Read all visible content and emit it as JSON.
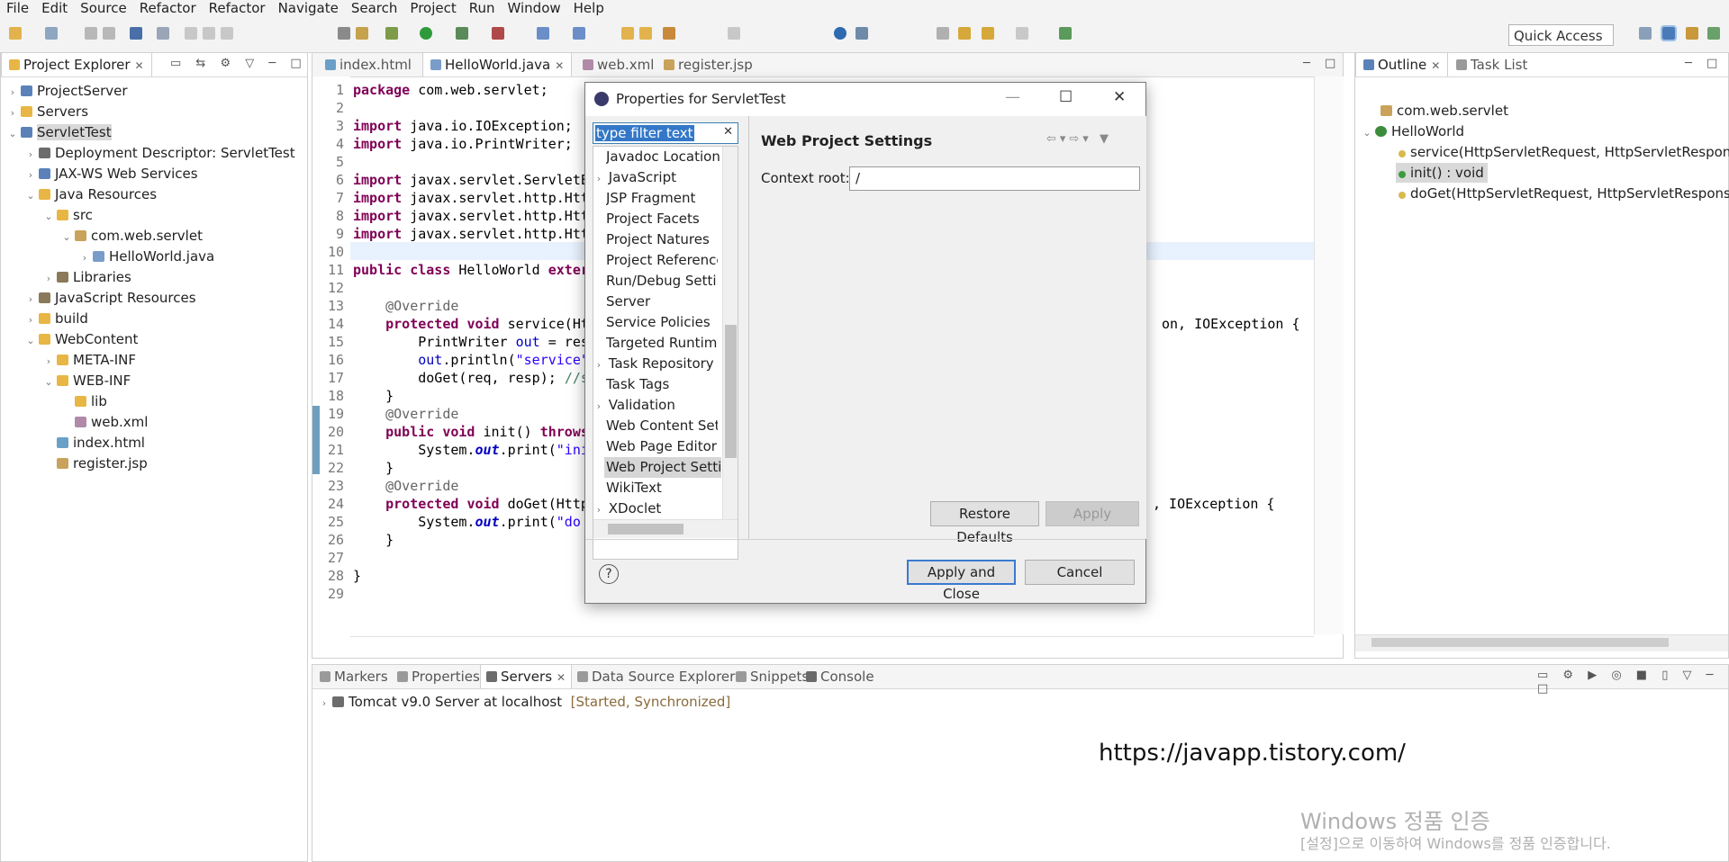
{
  "menu": [
    "File",
    "Edit",
    "Source",
    "Refactor",
    "Refactor",
    "Navigate",
    "Search",
    "Project",
    "Run",
    "Window",
    "Help"
  ],
  "quick_access": "Quick Access",
  "project_explorer": {
    "title": "Project Explorer",
    "items": [
      "ProjectServer",
      "Servers",
      "ServletTest",
      "Deployment Descriptor: ServletTest",
      "JAX-WS Web Services",
      "Java Resources",
      "src",
      "com.web.servlet",
      "HelloWorld.java",
      "Libraries",
      "JavaScript Resources",
      "build",
      "WebContent",
      "META-INF",
      "WEB-INF",
      "lib",
      "web.xml",
      "index.html",
      "register.jsp"
    ]
  },
  "editor": {
    "tabs": [
      "index.html",
      "HelloWorld.java",
      "web.xml",
      "register.jsp"
    ],
    "line_numbers": [
      "1",
      "2",
      "3",
      "4",
      "5",
      "6",
      "7",
      "8",
      "9",
      "10",
      "11",
      "12",
      "13",
      "14",
      "15",
      "16",
      "17",
      "18",
      "19",
      "20",
      "21",
      "22",
      "23",
      "24",
      "25",
      "26",
      "27",
      "28",
      "29"
    ]
  },
  "outline": {
    "title": "Outline",
    "tab2": "Task List",
    "items": [
      "com.web.servlet",
      "HelloWorld",
      "service(HttpServletRequest, HttpServletResponse) :",
      "init() : void",
      "doGet(HttpServletRequest, HttpServletResponse) :"
    ]
  },
  "bottom": {
    "tabs": [
      "Markers",
      "Properties",
      "Servers",
      "Data Source Explorer",
      "Snippets",
      "Console"
    ],
    "server_name": "Tomcat v9.0 Server at localhost",
    "server_status": "[Started, Synchronized]"
  },
  "dialog": {
    "title": "Properties for ServletTest",
    "filter": "type filter text",
    "items": [
      "Javadoc Location",
      "JavaScript",
      "JSP Fragment",
      "Project Facets",
      "Project Natures",
      "Project References",
      "Run/Debug Settings",
      "Server",
      "Service Policies",
      "Targeted Runtimes",
      "Task Repository",
      "Task Tags",
      "Validation",
      "Web Content Settings",
      "Web Page Editor",
      "Web Project Settings",
      "WikiText",
      "XDoclet"
    ],
    "page_title": "Web Project Settings",
    "context_label": "Context root:",
    "context_value": "/",
    "restore": "Restore Defaults",
    "apply": "Apply",
    "apply_close": "Apply and Close",
    "cancel": "Cancel",
    "help": "?"
  },
  "watermark": {
    "url": "https://javapp.tistory.com/",
    "win1": "Windows 정품 인증",
    "win2": "[설정]으로 이동하여 Windows를 정품 인증합니다."
  }
}
